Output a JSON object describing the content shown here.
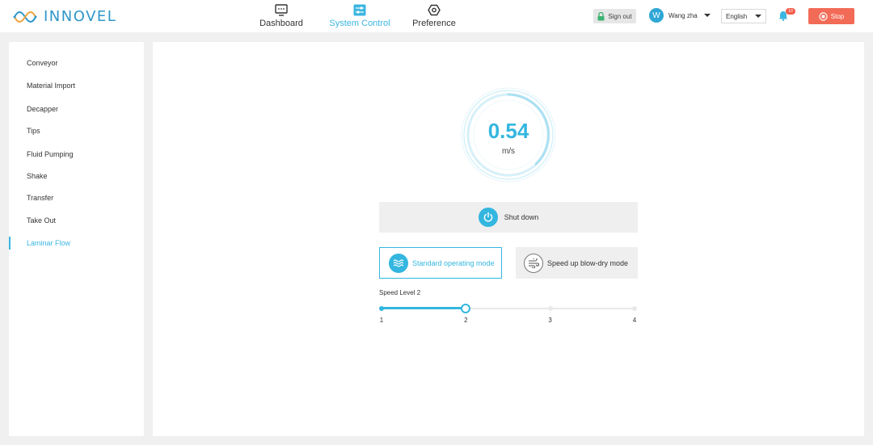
{
  "brand": {
    "name": "INNOVEL",
    "accent": "#2e97c9"
  },
  "nav": {
    "tabs": [
      {
        "label": "Dashboard",
        "icon": "monitor-icon",
        "active": false
      },
      {
        "label": "System Control",
        "icon": "sliders-icon",
        "active": true
      },
      {
        "label": "Preference",
        "icon": "gear-icon",
        "active": false
      }
    ]
  },
  "header": {
    "signout_label": "Sign out",
    "user": {
      "initial": "W",
      "name": "Wang zha"
    },
    "language": "English",
    "notifications_count": "10",
    "stop_label": "Stop",
    "stop_color": "#f26b57"
  },
  "sidebar": {
    "items": [
      {
        "label": "Conveyor",
        "active": false
      },
      {
        "label": "Material Import",
        "active": false
      },
      {
        "label": "Decapper",
        "active": false
      },
      {
        "label": "Tips",
        "active": false
      },
      {
        "label": "Fluid Pumping",
        "active": false
      },
      {
        "label": "Shake",
        "active": false
      },
      {
        "label": "Transfer",
        "active": false
      },
      {
        "label": "Take Out",
        "active": false
      },
      {
        "label": "Laminar Flow",
        "active": true
      }
    ]
  },
  "laminar": {
    "speed_value": "0.54",
    "speed_unit": "m/s",
    "shutdown_label": "Shut down",
    "modes": [
      {
        "label": "Standard operating mode",
        "icon": "waves-icon",
        "selected": true
      },
      {
        "label": "Speed up blow-dry mode",
        "icon": "wind-icon",
        "selected": false
      }
    ],
    "speed_level_label": "Speed Level 2",
    "speed_levels": [
      "1",
      "2",
      "3",
      "4"
    ],
    "speed_level_selected": 2,
    "accent": "#33b6df"
  }
}
